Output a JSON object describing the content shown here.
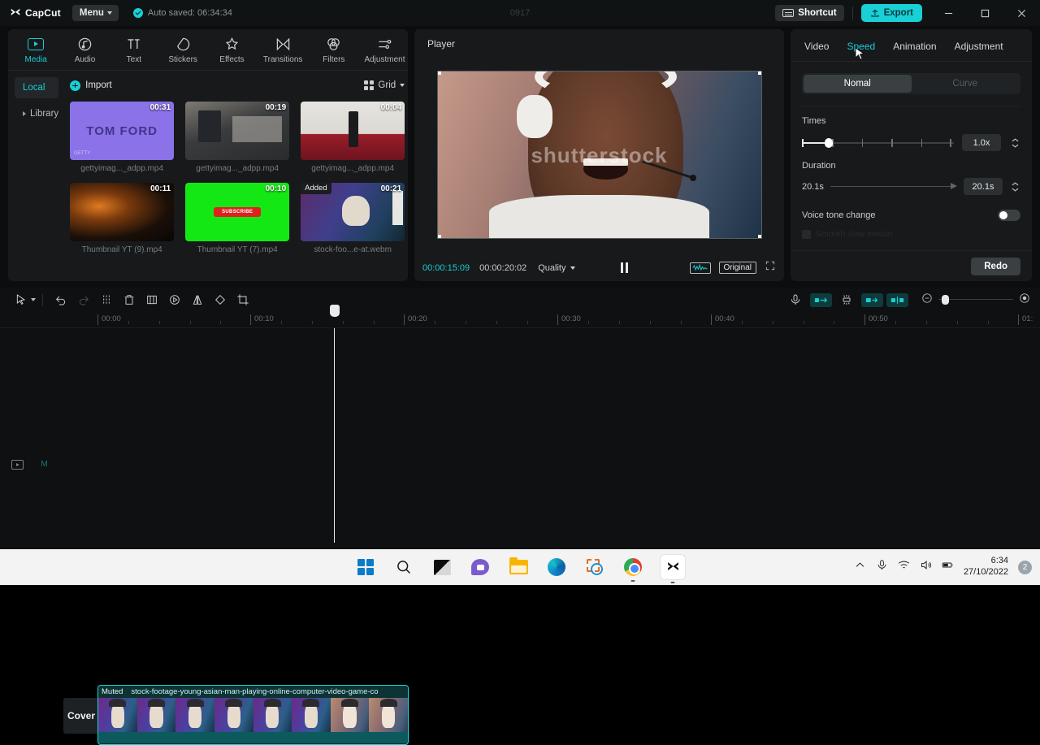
{
  "titlebar": {
    "app_name": "CapCut",
    "menu_label": "Menu",
    "autosave_text": "Auto saved: 06:34:34",
    "project_title": "0917",
    "shortcut_label": "Shortcut",
    "export_label": "Export",
    "minimize_label": "Minimize",
    "maximize_label": "Maximize",
    "close_label": "Close"
  },
  "left_panel": {
    "tabs": [
      {
        "label": "Media",
        "icon": "media-icon",
        "active": true
      },
      {
        "label": "Audio",
        "icon": "audio-icon",
        "active": false
      },
      {
        "label": "Text",
        "icon": "text-icon",
        "active": false
      },
      {
        "label": "Stickers",
        "icon": "stickers-icon",
        "active": false
      },
      {
        "label": "Effects",
        "icon": "effects-icon",
        "active": false
      },
      {
        "label": "Transitions",
        "icon": "transitions-icon",
        "active": false
      },
      {
        "label": "Filters",
        "icon": "filters-icon",
        "active": false
      },
      {
        "label": "Adjustment",
        "icon": "adjustment-icon",
        "active": false
      }
    ],
    "side_nav": [
      {
        "label": "Local",
        "active": true
      },
      {
        "label": "Library",
        "active": false
      }
    ],
    "import_label": "Import",
    "view_mode_label": "Grid",
    "media_items": [
      {
        "name": "gettyimag..._adpp.mp4",
        "duration": "00:31",
        "badge": "",
        "brand": "TOM FORD",
        "corner": "GETTY"
      },
      {
        "name": "gettyimag..._adpp.mp4",
        "duration": "00:19",
        "badge": "",
        "brand": "",
        "corner": ""
      },
      {
        "name": "gettyimag..._adpp.mp4",
        "duration": "00:04",
        "badge": "",
        "brand": "",
        "corner": ""
      },
      {
        "name": "Thumbnail YT (9).mp4",
        "duration": "00:11",
        "badge": "",
        "brand": "",
        "corner": ""
      },
      {
        "name": "Thumbnail YT (7).mp4",
        "duration": "00:10",
        "badge": "",
        "brand": "SUBSCRIBE",
        "corner": ""
      },
      {
        "name": "stock-foo...e-at.webm",
        "duration": "00:21",
        "badge": "Added",
        "brand": "",
        "corner": ""
      }
    ]
  },
  "player": {
    "title": "Player",
    "watermark": "shutterstock",
    "current_time": "00:00:15:09",
    "total_time": "00:00:20:02",
    "quality_label": "Quality",
    "playback_state": "pause",
    "original_label": "Original",
    "waveform_icon": "waveform-icon",
    "fullscreen_icon": "fullscreen-icon"
  },
  "right_panel": {
    "tabs": [
      {
        "label": "Video",
        "active": false
      },
      {
        "label": "Speed",
        "active": true
      },
      {
        "label": "Animation",
        "active": false
      },
      {
        "label": "Adjustment",
        "active": false
      }
    ],
    "mode_segments": [
      {
        "label": "Nomal",
        "active": true
      },
      {
        "label": "Curve",
        "active": false
      }
    ],
    "times_label": "Times",
    "times_value": "1.0x",
    "duration_label": "Duration",
    "duration_min": "20.1s",
    "duration_value": "20.1s",
    "voice_tone_label": "Voice tone change",
    "voice_tone_on": false,
    "disabled_option": "Smooth slow motion",
    "redo_label": "Redo"
  },
  "timeline": {
    "tools": [
      {
        "name": "select-tool-icon"
      },
      {
        "name": "undo-icon"
      },
      {
        "name": "redo-icon"
      },
      {
        "name": "split-icon"
      },
      {
        "name": "delete-icon"
      },
      {
        "name": "freeze-frame-icon"
      },
      {
        "name": "reverse-icon"
      },
      {
        "name": "mirror-icon"
      },
      {
        "name": "rotate-icon"
      },
      {
        "name": "crop-icon"
      }
    ],
    "right_tools": [
      {
        "name": "record-voiceover-icon"
      },
      {
        "name": "auto-fit-icon"
      },
      {
        "name": "adsorption-icon"
      },
      {
        "name": "fit-to-window-icon"
      },
      {
        "name": "split-view-icon"
      }
    ],
    "ruler_labels": [
      "00:00",
      "00:10",
      "00:20",
      "00:30",
      "00:40",
      "00:50",
      "01:"
    ],
    "track_cover_label": "Cover",
    "clip": {
      "muted_badge": "Muted",
      "name": "stock-footage-young-asian-man-playing-online-computer-video-game-co"
    },
    "zoom_out_icon": "zoom-out-icon",
    "zoom_in_icon": "zoom-in-icon"
  },
  "taskbar": {
    "icons": [
      {
        "name": "start-icon"
      },
      {
        "name": "search-icon"
      },
      {
        "name": "widgets-icon"
      },
      {
        "name": "teams-icon"
      },
      {
        "name": "file-explorer-icon"
      },
      {
        "name": "edge-icon"
      },
      {
        "name": "snipping-tool-icon"
      },
      {
        "name": "chrome-icon"
      },
      {
        "name": "capcut-icon"
      }
    ],
    "tray": [
      {
        "name": "show-hidden-icons-icon"
      },
      {
        "name": "microphone-icon"
      },
      {
        "name": "wifi-icon"
      },
      {
        "name": "volume-icon"
      },
      {
        "name": "battery-icon"
      }
    ],
    "time": "6:34",
    "date": "27/10/2022",
    "notification_count": "2"
  },
  "colors": {
    "accent": "#18cfd4",
    "panel_bg": "#17191b",
    "app_bg": "#0b0d0e",
    "taskbar_bg": "#f3f3f3"
  }
}
